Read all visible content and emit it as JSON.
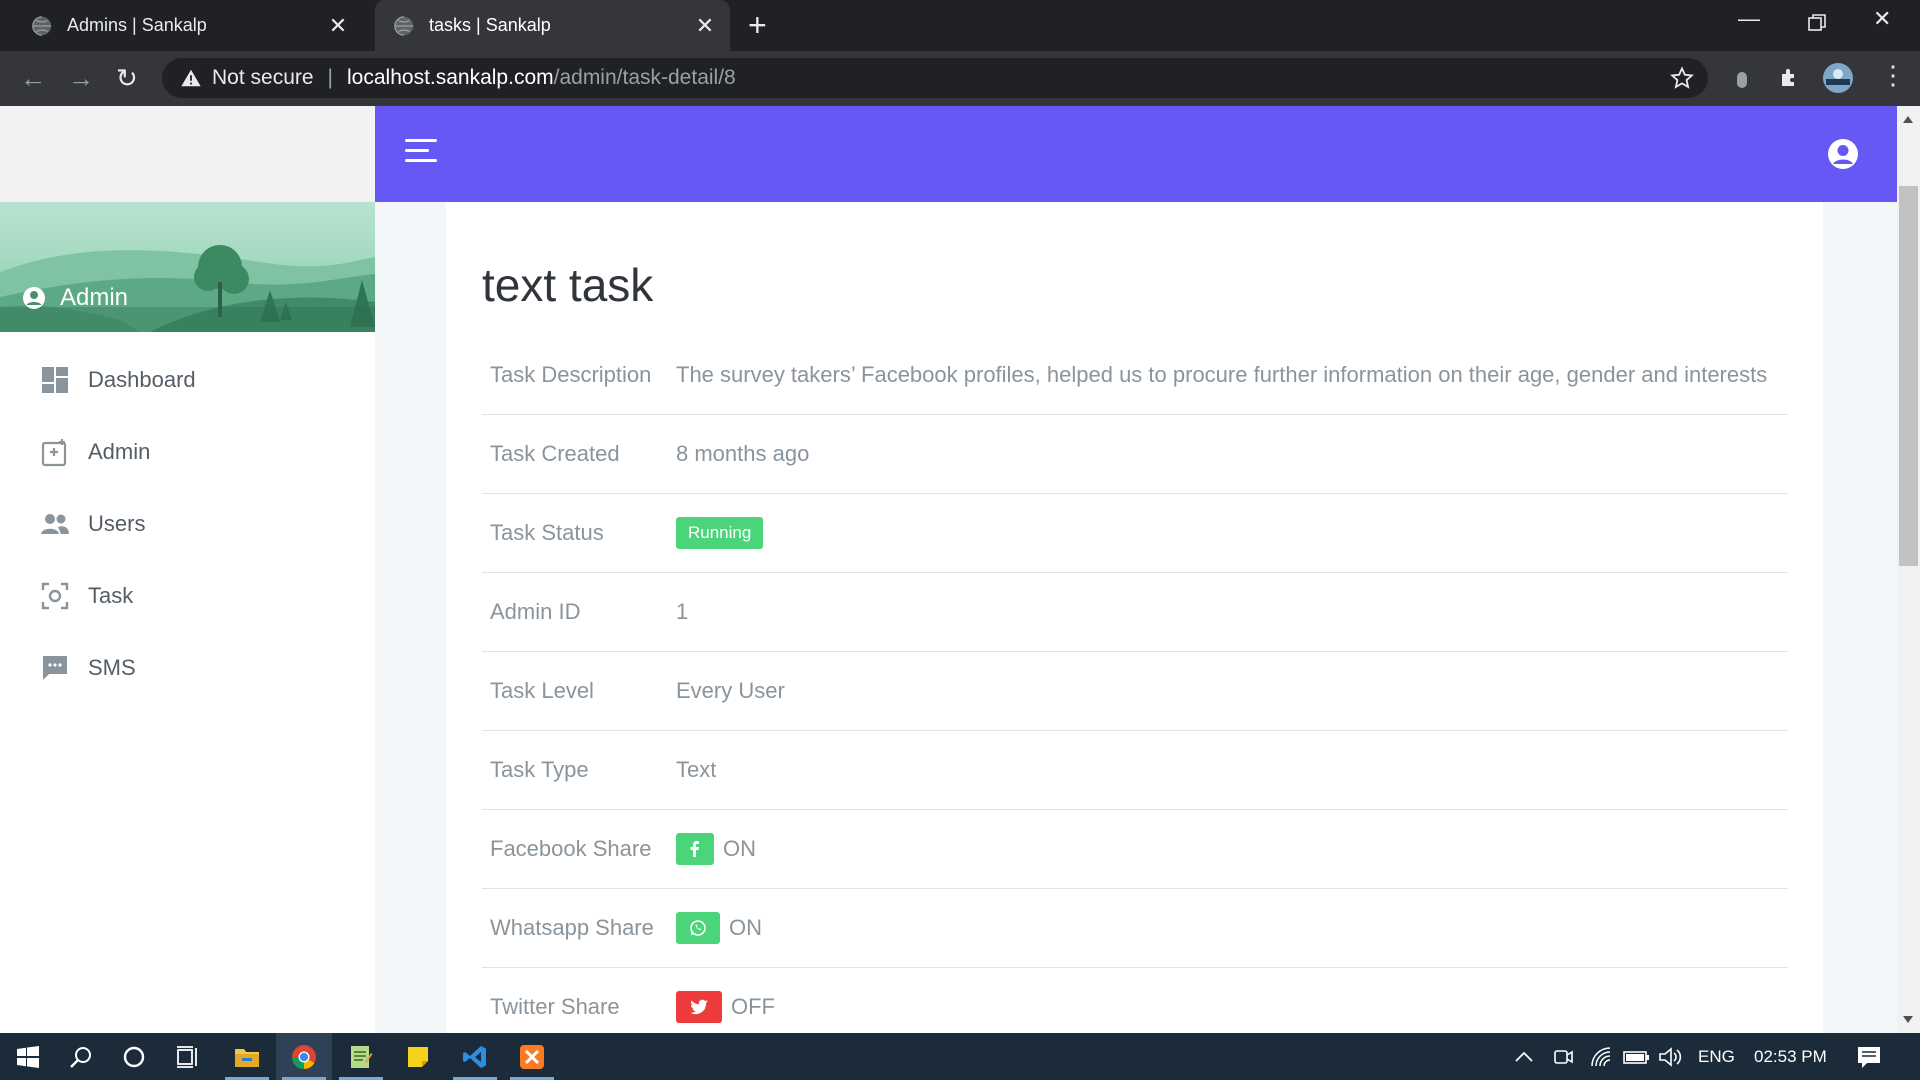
{
  "browser": {
    "tabs": [
      {
        "title": "Admins | Sankalp",
        "active": false
      },
      {
        "title": "tasks | Sankalp",
        "active": true
      }
    ],
    "security_label": "Not secure",
    "url_host": "localhost.sankalp.com",
    "url_path": "/admin/task-detail/8"
  },
  "sidebar": {
    "user_label": "Admin",
    "items": [
      {
        "label": "Dashboard",
        "icon": "dashboard-icon"
      },
      {
        "label": "Admin",
        "icon": "admin-icon"
      },
      {
        "label": "Users",
        "icon": "users-icon"
      },
      {
        "label": "Task",
        "icon": "task-icon"
      },
      {
        "label": "SMS",
        "icon": "sms-icon"
      }
    ]
  },
  "task": {
    "title": "text task",
    "rows": [
      {
        "label": "Task Description",
        "value": "The survey takers’ Facebook profiles, helped us to procure further information on their age, gender and interests"
      },
      {
        "label": "Task Created",
        "value": "8 months ago"
      },
      {
        "label": "Task Status",
        "value": "Running"
      },
      {
        "label": "Admin ID",
        "value": "1"
      },
      {
        "label": "Task Level",
        "value": "Every User"
      },
      {
        "label": "Task Type",
        "value": "Text"
      },
      {
        "label": "Facebook Share",
        "value": "ON"
      },
      {
        "label": "Whatsapp Share",
        "value": "ON"
      },
      {
        "label": "Twitter Share",
        "value": "OFF"
      }
    ]
  },
  "taskbar": {
    "language": "ENG",
    "time": "02:53 PM"
  },
  "colors": {
    "header": "#6658f5",
    "status_running": "#4cd47b",
    "share_on": "#4cd47b",
    "share_off": "#ee3b3b"
  }
}
